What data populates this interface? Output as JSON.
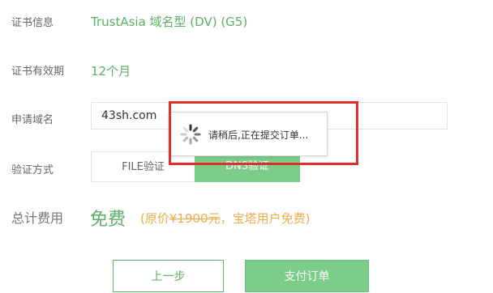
{
  "rows": {
    "cert_info": {
      "label": "证书信息",
      "value": "TrustAsia 域名型 (DV) (G5)"
    },
    "validity": {
      "label": "证书有效期",
      "value": "12个月"
    },
    "domain": {
      "label": "申请域名",
      "value": "43sh.com"
    },
    "method": {
      "label": "验证方式",
      "options": [
        "FILE验证",
        "DNS验证"
      ],
      "selected": "DNS验证"
    }
  },
  "total": {
    "label": "总计费用",
    "price": "免费",
    "note_open": "(原价",
    "original_price": "¥1900元",
    "note_close": "，宝塔用户免费)"
  },
  "buttons": {
    "prev": "上一步",
    "pay": "支付订单"
  },
  "loading": {
    "text": "请稍后,正在提交订单..."
  },
  "colors": {
    "green": "#5bb166",
    "green_fill": "#7ccc8a",
    "orange": "#f0ad4e",
    "highlight": "#e0302b"
  }
}
